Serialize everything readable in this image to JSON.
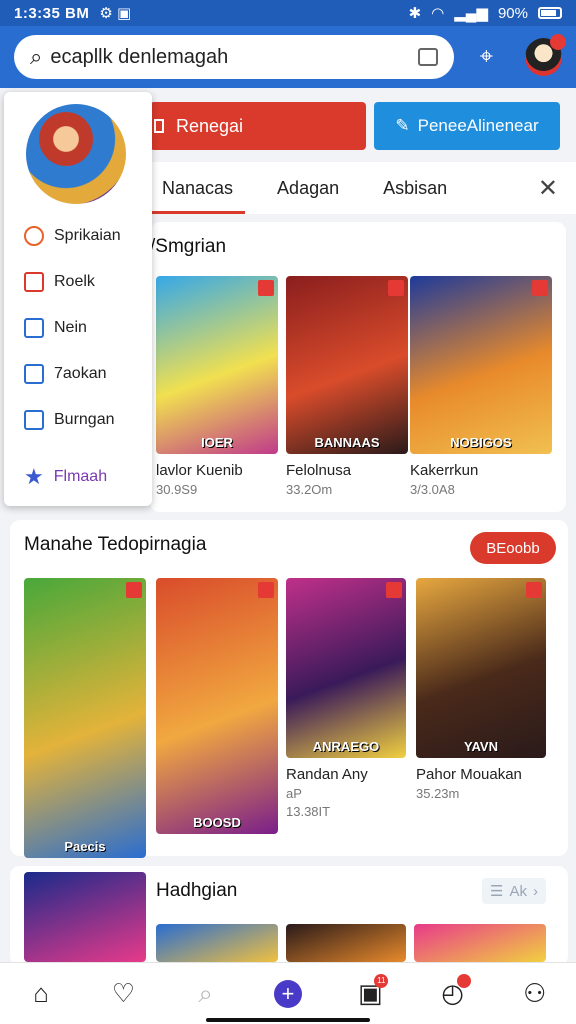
{
  "status": {
    "time": "1:3:35 BM",
    "battery": "90%"
  },
  "search": {
    "value": "ecapllk denlemagah"
  },
  "actions": {
    "red_label": "Renegai",
    "blue_label": "PeneeAlinenear"
  },
  "tabs": [
    {
      "label": "Nanacas",
      "active": true
    },
    {
      "label": "Adagan",
      "active": false
    },
    {
      "label": "Asbisan",
      "active": false
    }
  ],
  "side_menu": {
    "items": [
      {
        "label": "Sprikaian",
        "icon": "target-icon"
      },
      {
        "label": "Roelk",
        "icon": "screen-icon"
      },
      {
        "label": "Nein",
        "icon": "gear-icon"
      },
      {
        "label": "7aokan",
        "icon": "edit-icon"
      },
      {
        "label": "Burngan",
        "icon": "calendar-icon"
      }
    ],
    "featured": "Flmaah"
  },
  "section1": {
    "title": "/Smgrian",
    "games": [
      {
        "name": "lavlor Kuenib",
        "meta": "30.9S9",
        "banner": "IOER",
        "colors": [
          "#35a8e8",
          "#f1e050",
          "#c03a8a"
        ]
      },
      {
        "name": "Felolnusa",
        "meta": "33.2Om",
        "banner": "BANNAAS",
        "colors": [
          "#8a1e1e",
          "#d94c2b",
          "#2a1a1a"
        ]
      },
      {
        "name": "Kakerrkun",
        "meta": "3/3.0A8",
        "banner": "NOBIGOS",
        "colors": [
          "#1e3a9a",
          "#e88a2b",
          "#f1c050"
        ]
      }
    ]
  },
  "section2": {
    "title": "Manahe Tedopirnagia",
    "badge": "BEoobb",
    "games": [
      {
        "name": "",
        "meta": "",
        "banner": "Paecis",
        "colors": [
          "#48a83a",
          "#e3b33a",
          "#2a6dd0"
        ]
      },
      {
        "name": "",
        "meta": "",
        "banner": "BOOSD",
        "colors": [
          "#d94c2b",
          "#f1a840",
          "#7a1e8a"
        ]
      },
      {
        "name": "Randan Any",
        "meta": "13.38IT",
        "sub": "aP",
        "banner": "ANRAEGO",
        "colors": [
          "#c0308a",
          "#3a1a5a",
          "#f1d040"
        ]
      },
      {
        "name": "Pahor Mouakan",
        "meta": "35.23m",
        "banner": "YAVN",
        "colors": [
          "#e8a840",
          "#4a2a1a",
          "#2a1a1a"
        ]
      }
    ]
  },
  "section3": {
    "title": "Hadhgian",
    "list_label": "Ak"
  },
  "nav": {
    "badge1": "11",
    "badge2": ""
  }
}
